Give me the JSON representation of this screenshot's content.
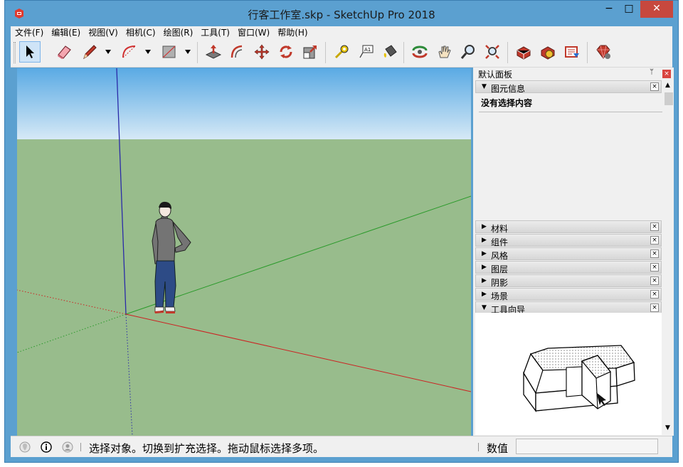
{
  "window": {
    "title": "行客工作室.skp - SketchUp Pro 2018",
    "minimize_glyph": "−",
    "maximize_glyph": "□",
    "close_glyph": "✕",
    "colors": {
      "titlebar": "#5ba0d0",
      "close": "#c7483e"
    }
  },
  "menu": [
    "文件(F)",
    "编辑(E)",
    "视图(V)",
    "相机(C)",
    "绘图(R)",
    "工具(T)",
    "窗口(W)",
    "帮助(H)"
  ],
  "toolbar": {
    "tools": [
      "select-icon",
      "eraser-icon",
      "pencil-icon",
      "arc-icon",
      "rectangle-icon",
      "push-pull-icon",
      "offset-icon",
      "move-icon",
      "rotate-icon",
      "scale-icon",
      "tape-measure-icon",
      "text-icon",
      "paint-bucket-icon",
      "orbit-icon",
      "pan-icon",
      "zoom-icon",
      "zoom-extents-icon",
      "3d-warehouse-icon",
      "extension-warehouse-icon",
      "layout-icon",
      "extension-manager-icon"
    ],
    "text_tool_label": "A1"
  },
  "viewport": {
    "sky_color_top": "#5aaae4",
    "sky_color_bottom": "#d6e9f6",
    "ground_color": "#98bc8c",
    "axis_colors": {
      "x": "#cc2222",
      "y": "#2a9a2a",
      "z": "#2a2aa8"
    }
  },
  "tray": {
    "title": "默认面板",
    "pin_glyph": "ᛘ",
    "close_glyph": "×",
    "entity_info": {
      "label": "图元信息",
      "content": "没有选择内容"
    },
    "collapsed_panels": [
      "材料",
      "组件",
      "风格",
      "图层",
      "阴影",
      "场景"
    ],
    "instructor": {
      "label": "工具向导"
    }
  },
  "statusbar": {
    "hint": "选择对象。切换到扩充选择。拖动鼠标选择多项。",
    "measurements_label": "数值",
    "measurements_value": ""
  }
}
